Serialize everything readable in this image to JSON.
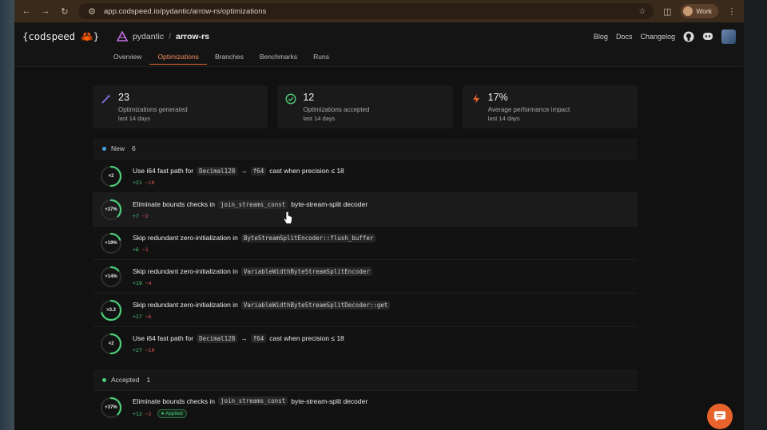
{
  "browser": {
    "url": "app.codspeed.io/pydantic/arrow-rs/optimizations",
    "profile_label": "Work"
  },
  "header": {
    "logo_text": "{codspeed",
    "logo_close": "}",
    "org": "pydantic",
    "separator": "/",
    "repo": "arrow-rs",
    "links": [
      "Blog",
      "Docs",
      "Changelog"
    ]
  },
  "tabs": [
    {
      "label": "Overview",
      "active": false
    },
    {
      "label": "Optimizations",
      "active": true
    },
    {
      "label": "Branches",
      "active": false
    },
    {
      "label": "Benchmarks",
      "active": false
    },
    {
      "label": "Runs",
      "active": false
    }
  ],
  "stats": [
    {
      "icon": "magic-wand-icon",
      "value": "23",
      "label": "Optimizations generated",
      "sub": "last 14 days",
      "color": "#8b7cf6"
    },
    {
      "icon": "check-circle-icon",
      "value": "12",
      "label": "Optimizations accepted",
      "sub": "last 14 days",
      "color": "#4ccf7a"
    },
    {
      "icon": "lightning-icon",
      "value": "17%",
      "label": "Average performance impact",
      "sub": "last 14 days",
      "color": "#e8632b"
    }
  ],
  "sections": {
    "new": {
      "label": "New",
      "count": "6",
      "dot_color": "#4aa3df",
      "rows": [
        {
          "impact": "×2",
          "fraction": 0.5,
          "pre": "Use i64 fast path for",
          "code1": "Decimal128",
          "arrow": "→",
          "code2": "f64",
          "post": "cast when precision ≤ 18",
          "plus": "+21",
          "minus": "−10"
        },
        {
          "impact": "+37%",
          "fraction": 0.37,
          "pre": "Eliminate bounds checks in",
          "code1": "join_streams_const",
          "arrow": "",
          "code2": "",
          "post": "byte-stream-split decoder",
          "plus": "+7",
          "minus": "−2"
        },
        {
          "impact": "+19%",
          "fraction": 0.19,
          "pre": "Skip redundant zero-initialization in",
          "code1": "ByteStreamSplitEncoder::flush_buffer",
          "arrow": "",
          "code2": "",
          "post": "",
          "plus": "+6",
          "minus": "−1"
        },
        {
          "impact": "+14%",
          "fraction": 0.14,
          "pre": "Skip redundant zero-initialization in",
          "code1": "VariableWidthByteStreamSplitEncoder",
          "arrow": "",
          "code2": "",
          "post": "",
          "plus": "+19",
          "minus": "−4"
        },
        {
          "impact": "×3.2",
          "fraction": 0.7,
          "pre": "Skip redundant zero-initialization in",
          "code1": "VariableWidthByteStreamSplitDecoder::get",
          "arrow": "",
          "code2": "",
          "post": "",
          "plus": "+17",
          "minus": "−6"
        },
        {
          "impact": "×2",
          "fraction": 0.5,
          "pre": "Use i64 fast path for",
          "code1": "Decimal128",
          "arrow": "→",
          "code2": "f64",
          "post": "cast when precision ≤ 18",
          "plus": "+27",
          "minus": "−10"
        }
      ]
    },
    "accepted": {
      "label": "Accepted",
      "count": "1",
      "dot_color": "#4ccf7a",
      "rows": [
        {
          "impact": "+37%",
          "fraction": 0.37,
          "pre": "Eliminate bounds checks in",
          "code1": "join_streams_const",
          "arrow": "",
          "code2": "",
          "post": "byte-stream-split decoder",
          "plus": "+12",
          "minus": "−2",
          "badge": "Applied"
        }
      ]
    }
  },
  "colors": {
    "accent": "#e8632b",
    "ring": "#4ccf7a"
  }
}
